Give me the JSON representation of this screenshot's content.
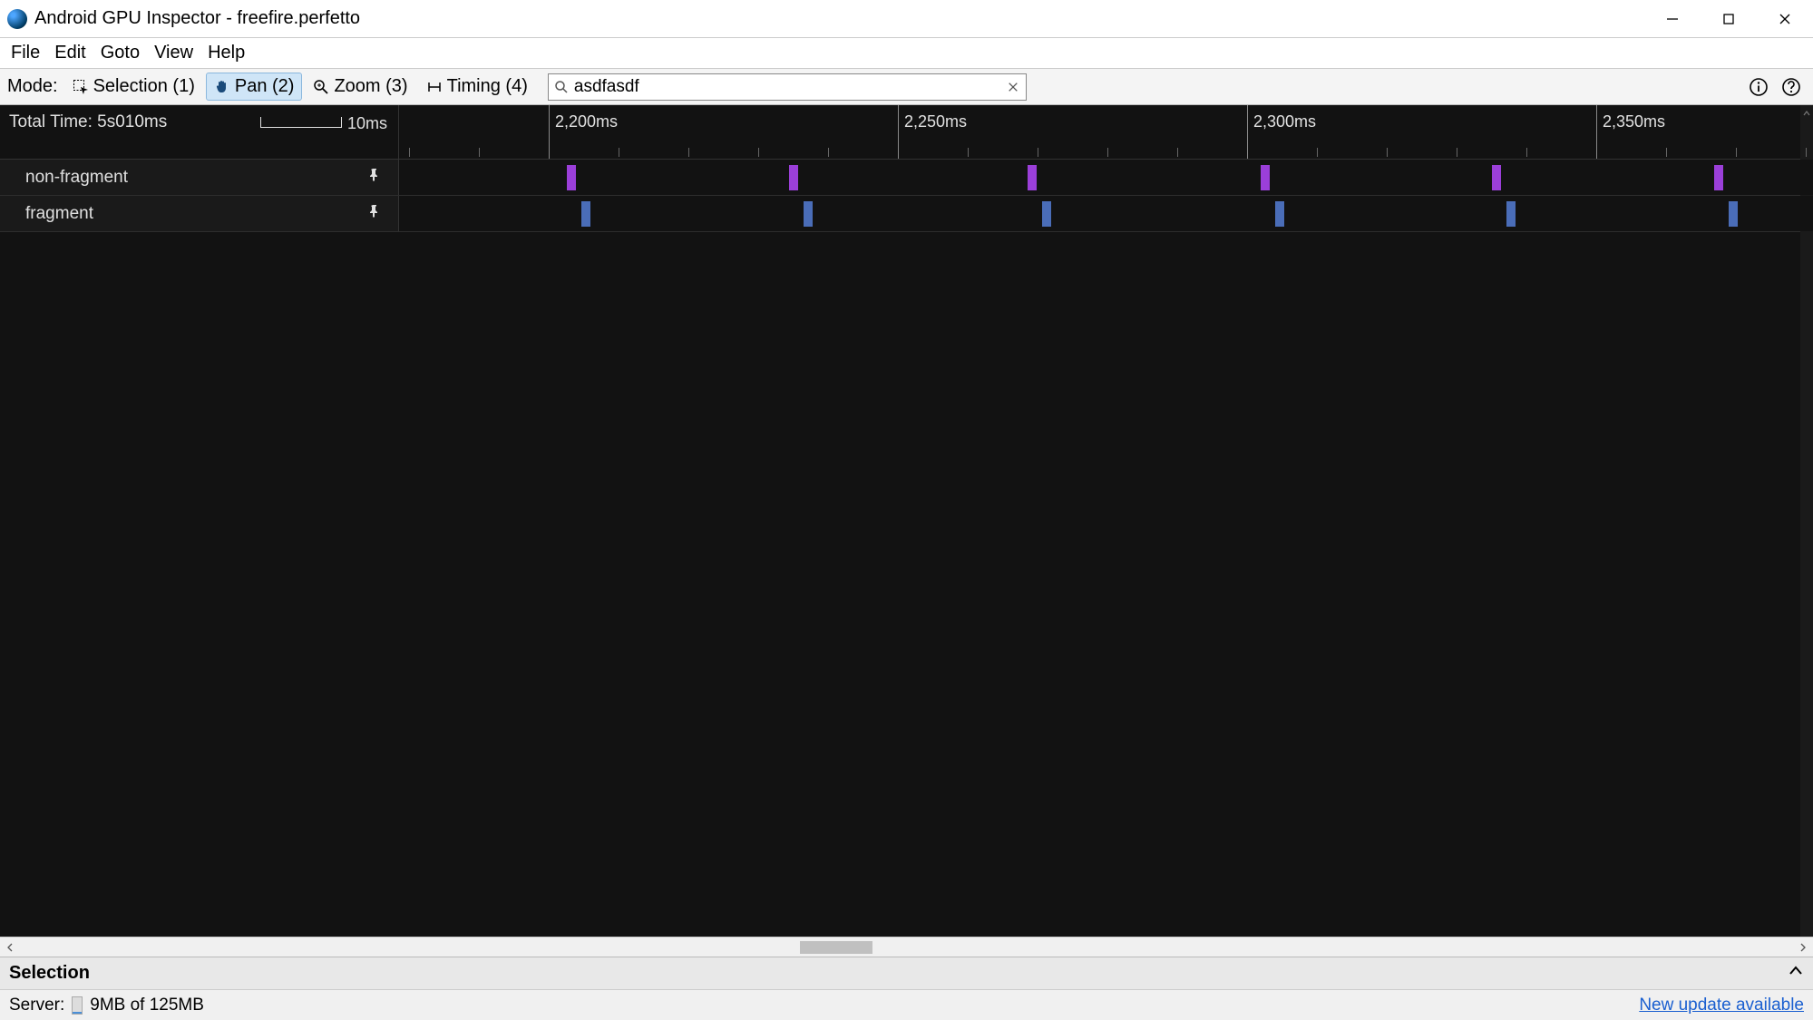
{
  "window": {
    "title": "Android GPU Inspector - freefire.perfetto"
  },
  "menu": {
    "file": "File",
    "edit": "Edit",
    "goto": "Goto",
    "view": "View",
    "help": "Help"
  },
  "toolbar": {
    "mode_label": "Mode:",
    "selection": "Selection (1)",
    "pan": "Pan (2)",
    "zoom": "Zoom (3)",
    "timing": "Timing (4)"
  },
  "search": {
    "value": "asdfasdf"
  },
  "timeline": {
    "total_time_label": "Total Time: 5s010ms",
    "scale_label": "10ms",
    "major_ticks": [
      "2,200ms",
      "2,250ms",
      "2,300ms",
      "2,350ms"
    ],
    "tracks": [
      {
        "name": "non-fragment"
      },
      {
        "name": "fragment"
      }
    ]
  },
  "selection_panel": {
    "title": "Selection"
  },
  "status": {
    "server_label": "Server:",
    "memory": "9MB of 125MB",
    "update_link": "New update available"
  }
}
